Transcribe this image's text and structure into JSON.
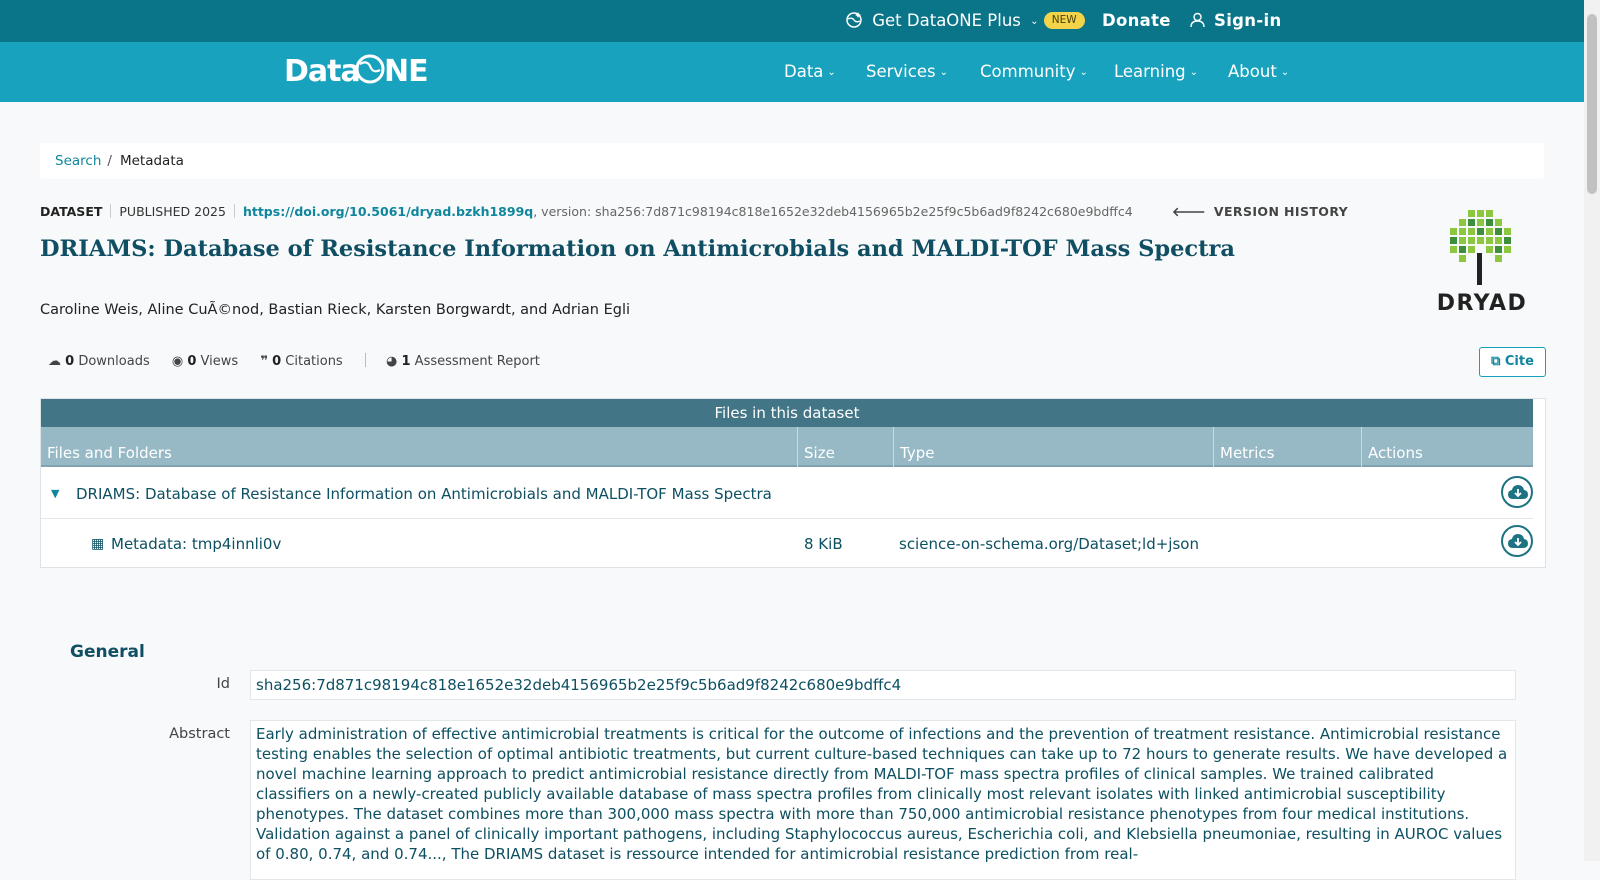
{
  "topbar": {
    "plus_label": "Get DataONE Plus",
    "new_badge": "NEW",
    "donate_label": "Donate",
    "signin_label": "Sign-in"
  },
  "navbar": {
    "logo_text": "DataONE",
    "items": [
      {
        "label": "Data"
      },
      {
        "label": "Services"
      },
      {
        "label": "Community"
      },
      {
        "label": "Learning"
      },
      {
        "label": "About"
      }
    ]
  },
  "breadcrumb": {
    "items": [
      {
        "label": "Search"
      },
      {
        "label": "Metadata"
      }
    ],
    "separator": "/"
  },
  "dataset": {
    "type_label": "DATASET",
    "published": "PUBLISHED 2025",
    "doi": "https://doi.org/10.5061/dryad.bzkh1899q",
    "version": ", version: sha256:7d871c98194c818e1652e32deb4156965b2e25f9c5b6ad9f8242c680e9bdffc4",
    "version_history_label": "VERSION HISTORY",
    "title": "DRIAMS: Database of Resistance Information on Antimicrobials and MALDI-TOF Mass Spectra",
    "authors": "Caroline Weis, Aline CuÃ©nod, Bastian Rieck, Karsten Borgwardt, and Adrian Egli",
    "repository_name": "DRYAD",
    "metrics": {
      "downloads_count": "0",
      "downloads_label": "Downloads",
      "views_count": "0",
      "views_label": "Views",
      "citations_count": "0",
      "citations_label": "Citations",
      "assessment_count": "1",
      "assessment_label": "Assessment Report"
    },
    "cite_label": "Cite"
  },
  "files": {
    "table_title": "Files in this dataset",
    "columns": [
      "Files and Folders",
      "Size",
      "Type",
      "Metrics",
      "Actions"
    ],
    "rows": [
      {
        "name": "DRIAMS: Database of Resistance Information on Antimicrobials and MALDI-TOF Mass Spectra",
        "size": "",
        "type": ""
      },
      {
        "name": "Metadata: tmp4innli0v",
        "size": "8 KiB",
        "type": "science-on-schema.org/Dataset;ld+json"
      }
    ]
  },
  "general": {
    "section_title": "General",
    "id_label": "Id",
    "id_value": "sha256:7d871c98194c818e1652e32deb4156965b2e25f9c5b6ad9f8242c680e9bdffc4",
    "abstract_label": "Abstract",
    "abstract_value": "Early administration of effective antimicrobial treatments is critical for the outcome of infections and the prevention of treatment resistance. Antimicrobial resistance testing enables the selection of optimal antibiotic treatments, but current culture-based techniques can take up to 72 hours to generate results. We have developed a novel machine learning approach to predict antimicrobial resistance directly from MALDI-TOF mass spectra profiles of clinical samples. We trained calibrated classifiers on a newly-created publicly available database of mass spectra profiles from clinically most relevant isolates with linked antimicrobial susceptibility phenotypes. The dataset combines more than 300,000 mass spectra with more than 750,000 antimicrobial resistance phenotypes from four medical institutions. Validation against a panel of clinically important pathogens, including Staphylococcus aureus, Escherichia coli, and Klebsiella pneumoniae, resulting in AUROC values of 0.80, 0.74, and 0.74..., The DRIAMS dataset is ressource intended for antimicrobial resistance prediction from real-"
  },
  "colors": {
    "topbar": "#0a7489",
    "navbar": "#18a2be",
    "title": "#0f4e63",
    "link": "#10869e",
    "table_title": "#427586",
    "table_header": "#97b9c6"
  }
}
